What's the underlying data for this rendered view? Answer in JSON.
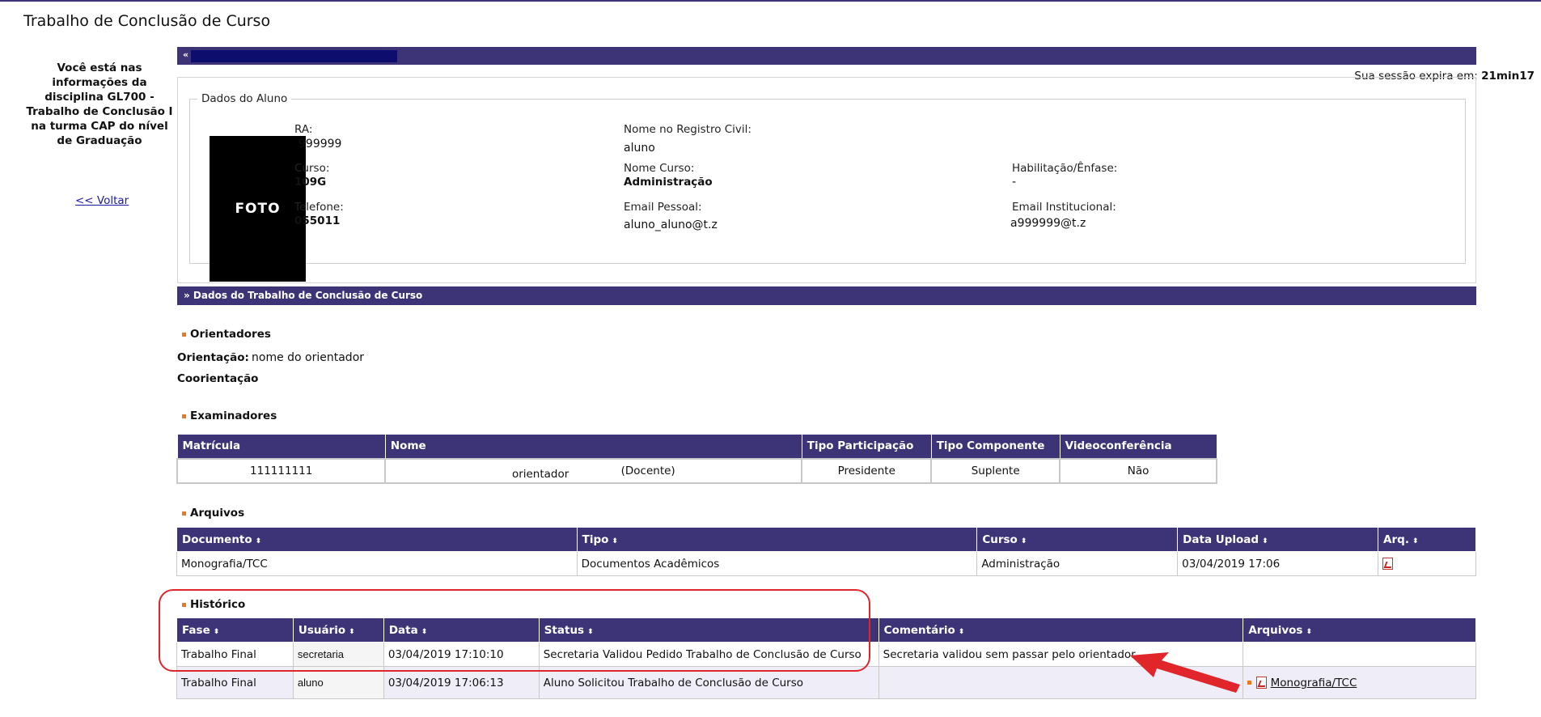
{
  "page": {
    "title": "Trabalho de Conclusão de Curso"
  },
  "left_panel": {
    "info": "Você está nas informações da disciplina GL700 - Trabalho de Conclusão I na turma CAP do nível de Graduação",
    "back_link": "<< Voltar"
  },
  "top_bar": {
    "collapse": "«"
  },
  "session": {
    "label": "Sua sessão expira em:",
    "time": "21min17"
  },
  "student": {
    "legend": "Dados do Aluno",
    "photo": "FOTO",
    "ra_label": "RA:",
    "ra": "999999",
    "nome_registro_label": "Nome no Registro Civil:",
    "nome_registro": "aluno",
    "curso_label": "Curso:",
    "curso": "109G",
    "nome_curso_label": "Nome Curso:",
    "nome_curso": "Administração",
    "habilitacao_label": "Habilitação/Ênfase:",
    "habilitacao": "-",
    "telefone_label": "Telefone:",
    "telefone": "055011",
    "email_pessoal_label": "Email Pessoal:",
    "email_pessoal": "aluno_aluno@t.z",
    "email_inst_label": "Email Institucional:",
    "email_inst": "a999999@t.z"
  },
  "tcc_bar": {
    "label": "» Dados do Trabalho de Conclusão de Curso"
  },
  "orientadores": {
    "heading": "Orientadores",
    "orientacao_label": "Orientação:",
    "orientacao": "nome do orientador",
    "coorientacao_label": "Coorientação"
  },
  "examinadores": {
    "heading": "Examinadores",
    "columns": [
      "Matrícula",
      "Nome",
      "Tipo Participação",
      "Tipo Componente",
      "Videoconferência"
    ],
    "rows": [
      {
        "matricula": "111111111",
        "nome": "orientador",
        "tipo": "(Docente)",
        "participacao": "Presidente",
        "componente": "Suplente",
        "video": "Não"
      }
    ]
  },
  "arquivos": {
    "heading": "Arquivos",
    "columns": [
      "Documento",
      "Tipo",
      "Curso",
      "Data Upload",
      "Arq."
    ],
    "sort_icon": "⬍",
    "rows": [
      {
        "documento": "Monografia/TCC",
        "tipo": "Documentos Acadêmicos",
        "curso": "Administração",
        "data": "03/04/2019 17:06",
        "icon": "pdf-icon"
      }
    ]
  },
  "historico": {
    "heading": "Histórico",
    "columns": [
      "Fase",
      "Usuário",
      "Data",
      "Status",
      "Comentário",
      "Arquivos"
    ],
    "rows": [
      {
        "fase": "Trabalho Final",
        "usuario": "secretaria",
        "data": "03/04/2019 17:10:10",
        "status": "Secretaria Validou Pedido Trabalho de Conclusão de Curso",
        "comentario": "Secretaria validou sem passar pelo orientador",
        "arquivo": ""
      },
      {
        "fase": "Trabalho Final",
        "usuario": "aluno",
        "data": "03/04/2019 17:06:13",
        "status": "Aluno Solicitou Trabalho de Conclusão de Curso",
        "comentario": "",
        "arquivo": "Monografia/TCC"
      }
    ]
  },
  "colors": {
    "header_purple": "#3d3478",
    "bullet_orange": "#e87a1c",
    "annotation_red": "#e0262b",
    "row_alt": "#efeef8"
  }
}
